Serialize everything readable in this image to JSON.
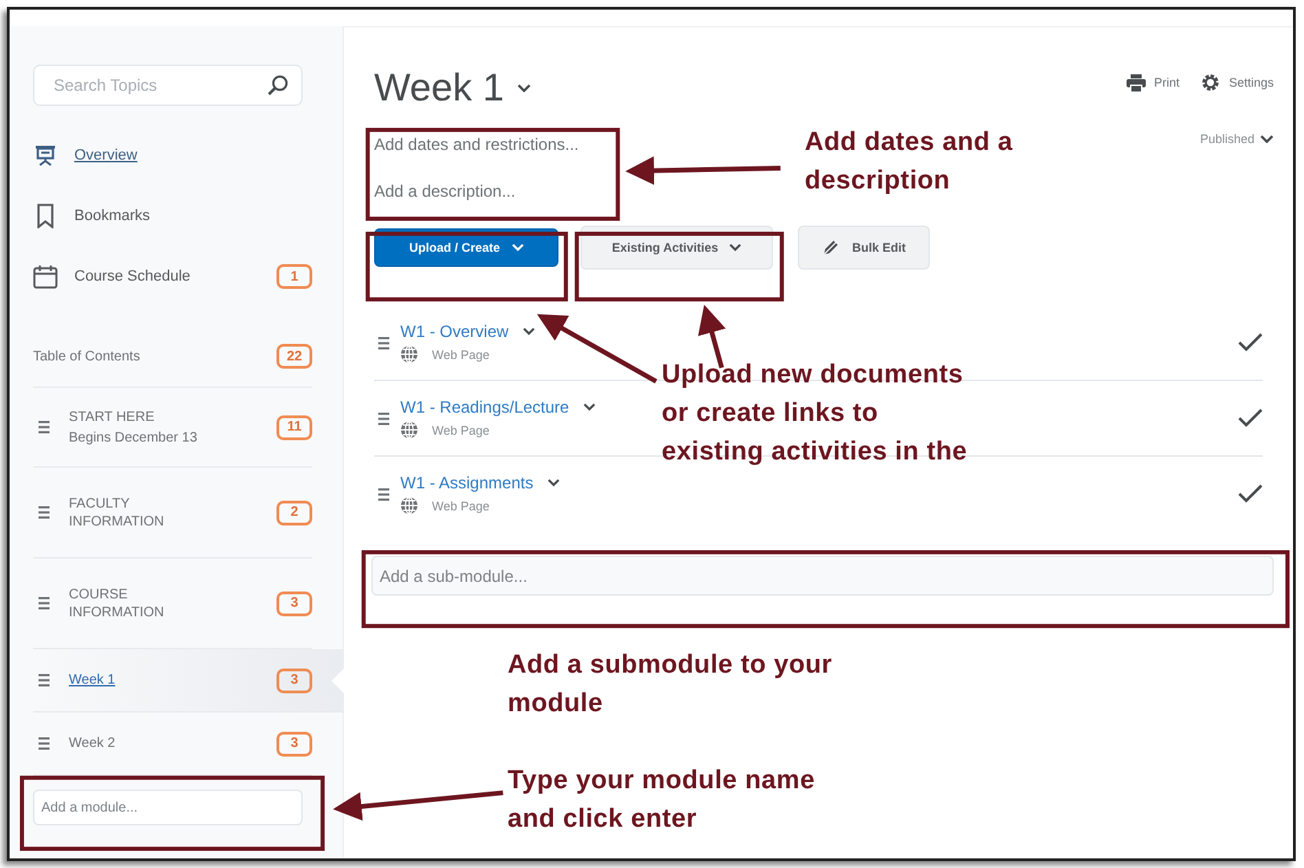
{
  "sidebar": {
    "search": {
      "placeholder": "Search Topics"
    },
    "nav": [
      {
        "kind": "overview",
        "label": "Overview",
        "selected": true
      },
      {
        "kind": "bookmarks",
        "label": "Bookmarks",
        "selected": false
      },
      {
        "kind": "schedule",
        "label": "Course Schedule",
        "selected": false,
        "count": "1"
      }
    ],
    "toc": {
      "label": "Table of Contents",
      "count": "22"
    },
    "modules": [
      {
        "title": "START HERE",
        "subtitle": "Begins December 13",
        "count": "11",
        "selected": false
      },
      {
        "title": "FACULTY INFORMATION",
        "count": "2",
        "selected": false
      },
      {
        "title": "COURSE INFORMATION",
        "count": "3",
        "selected": false
      },
      {
        "title": "Week 1",
        "count": "3",
        "selected": true
      },
      {
        "title": "Week 2",
        "count": "3",
        "selected": false
      }
    ],
    "add_module": {
      "placeholder": "Add a module..."
    }
  },
  "main": {
    "title": "Week 1",
    "actions": [
      {
        "kind": "print",
        "label": "Print"
      },
      {
        "kind": "settings",
        "label": "Settings"
      }
    ],
    "dates_link": "Add dates and restrictions...",
    "status": "Published",
    "description_link": "Add a description...",
    "buttons": [
      {
        "kind": "primary",
        "label": "Upload / Create"
      },
      {
        "kind": "dropdown",
        "label": "Existing Activities"
      },
      {
        "kind": "bulk",
        "label": "Bulk Edit"
      }
    ],
    "topics": [
      {
        "title": "W1 - Overview",
        "type": "Web Page",
        "completed": true
      },
      {
        "title": "W1 - Readings/Lecture",
        "type": "Web Page",
        "completed": true
      },
      {
        "title": "W1 - Assignments",
        "type": "Web Page",
        "completed": true
      }
    ],
    "add_submodule": {
      "placeholder": "Add a sub-module..."
    }
  },
  "annotations": [
    "Add dates and a description",
    "Upload new documents or create links to existing activities in the",
    "Add a submodule to your module",
    "Type your module name and click enter"
  ]
}
